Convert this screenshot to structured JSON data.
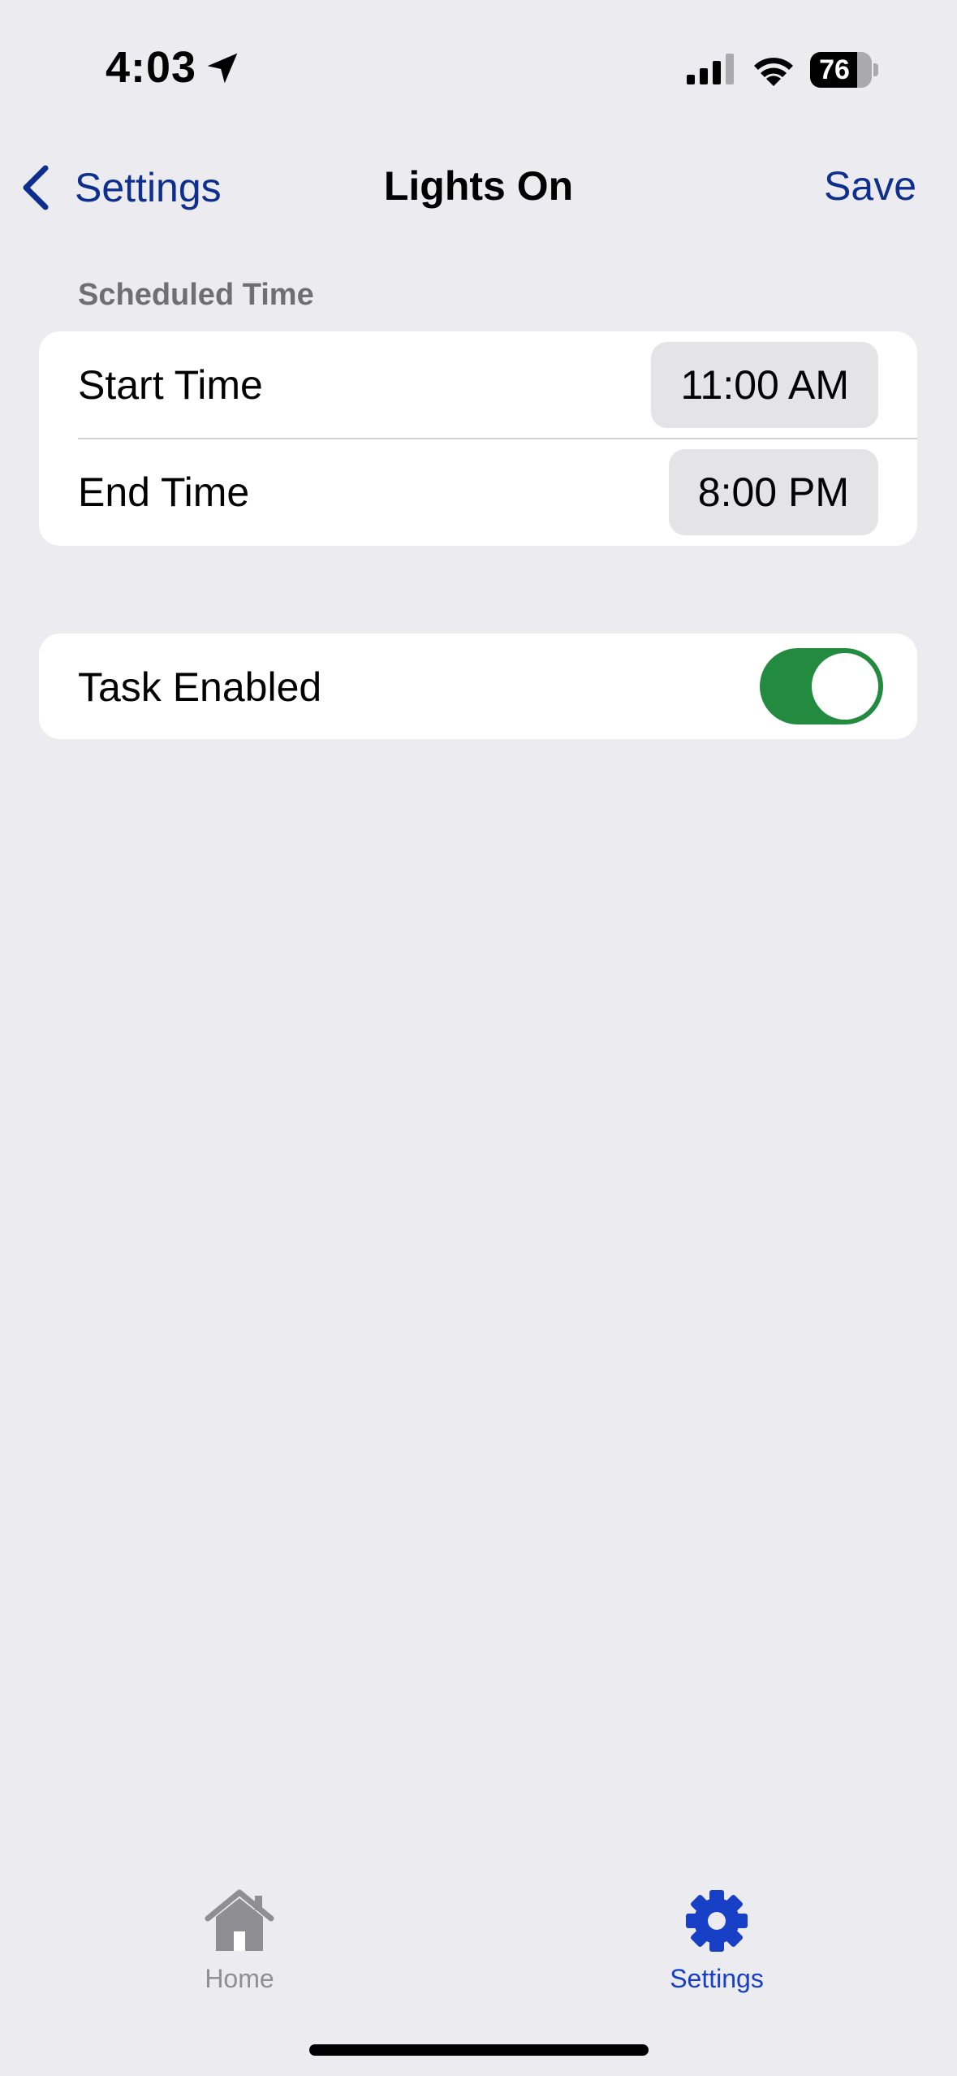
{
  "status_bar": {
    "time": "4:03",
    "battery_level": "76",
    "battery_fraction": 0.76,
    "icons": [
      "location-arrow-icon",
      "signal-icon",
      "wifi-icon",
      "battery-icon"
    ]
  },
  "nav": {
    "back_label": "Settings",
    "title": "Lights On",
    "save_label": "Save"
  },
  "schedule": {
    "header": "Scheduled Time",
    "rows": [
      {
        "label": "Start Time",
        "value": "11:00 AM"
      },
      {
        "label": "End Time",
        "value": "8:00 PM"
      }
    ]
  },
  "task": {
    "label": "Task Enabled",
    "enabled": true
  },
  "tab_bar": {
    "tabs": [
      {
        "label": "Home",
        "icon": "home-icon",
        "active": false
      },
      {
        "label": "Settings",
        "icon": "gear-icon",
        "active": true
      }
    ]
  },
  "colors": {
    "accent": "#0E2F8E",
    "tab_active": "#1740C6",
    "tab_inactive": "#8E8E93",
    "toggle_on": "#228B3F",
    "background": "#EBEBF0"
  }
}
